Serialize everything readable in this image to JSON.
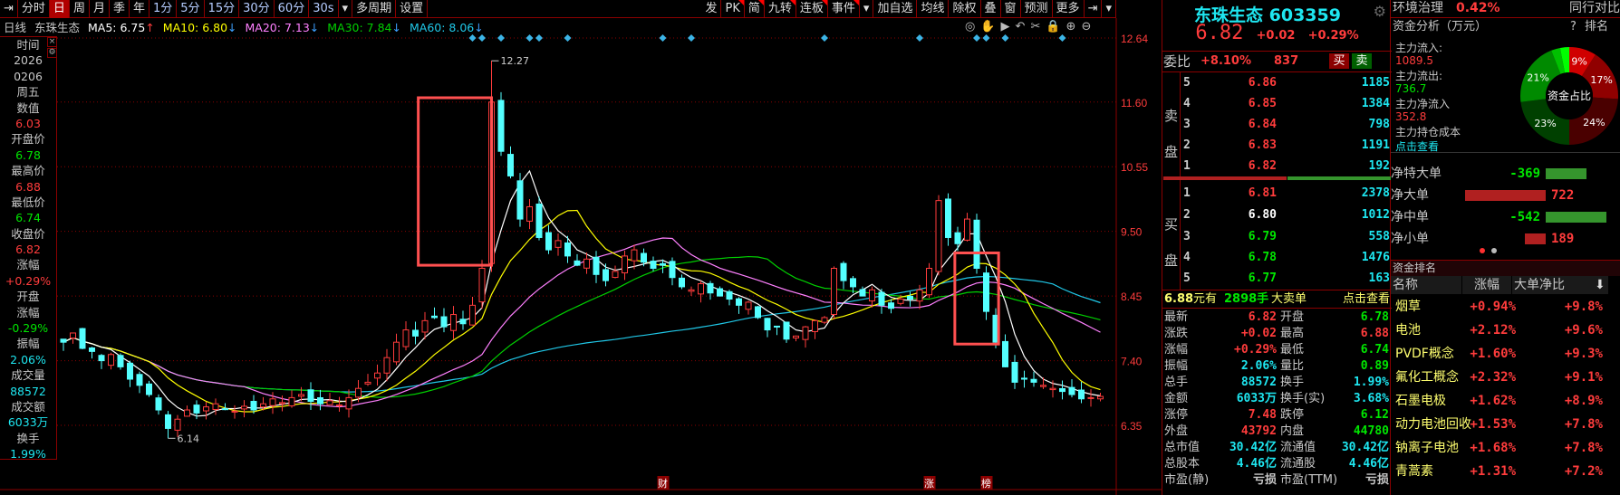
{
  "toolbar": {
    "left": [
      {
        "label": "⇥",
        "icon": "collapse-icon"
      },
      {
        "label": "分时"
      },
      {
        "label": "日",
        "active": true
      },
      {
        "label": "周"
      },
      {
        "label": "月"
      },
      {
        "label": "季"
      },
      {
        "label": "年"
      },
      {
        "label": "1分",
        "blue": true
      },
      {
        "label": "5分",
        "blue": true
      },
      {
        "label": "15分",
        "blue": true
      },
      {
        "label": "30分",
        "blue": true
      },
      {
        "label": "60分",
        "blue": true
      },
      {
        "label": "30s",
        "blue": true
      },
      {
        "label": "▾",
        "icon": "dropdown-icon"
      },
      {
        "label": "多周期"
      },
      {
        "label": "设置"
      }
    ],
    "right": [
      {
        "label": "发"
      },
      {
        "label": "PK",
        "flag": true
      },
      {
        "label": "简",
        "flag": true
      },
      {
        "label": "九转",
        "flag": true
      },
      {
        "label": "连板",
        "flag": true
      },
      {
        "label": "事件",
        "flag": true
      },
      {
        "label": "▾",
        "icon": "dropdown-icon"
      },
      {
        "label": "加自选"
      },
      {
        "label": "均线"
      },
      {
        "label": "除权"
      },
      {
        "label": "叠"
      },
      {
        "label": "窗"
      },
      {
        "label": "预测"
      },
      {
        "label": "更多"
      },
      {
        "label": "⇥",
        "icon": "expand-icon"
      },
      {
        "label": "▾",
        "icon": "dropdown-icon"
      }
    ],
    "chart_tools": [
      "eye-icon",
      "hand-icon",
      "play-icon",
      "undo-icon",
      "scissors-icon",
      "lock-icon",
      "zoom-in-icon",
      "zoom-out-icon"
    ]
  },
  "ma_row": {
    "period": "日线",
    "name": "东珠生态",
    "ma5": "MA5: 6.75",
    "ma5_arrow": "↑",
    "ma10": "MA10: 6.80",
    "ma10_arrow": "↓",
    "ma20": "MA20: 7.13",
    "ma20_arrow": "↓",
    "ma30": "MA30: 7.84",
    "ma30_arrow": "↓",
    "ma60": "MA60: 8.06",
    "ma60_arrow": "↓"
  },
  "left_panel": [
    [
      "时间",
      "gr"
    ],
    [
      "2026",
      "gr"
    ],
    [
      "0206",
      "gr"
    ],
    [
      "周五",
      "gr"
    ],
    [
      "数值",
      "gr"
    ],
    [
      "6.03",
      "r"
    ],
    [
      "开盘价",
      "gr"
    ],
    [
      "6.78",
      "g"
    ],
    [
      "最高价",
      "gr"
    ],
    [
      "6.88",
      "r"
    ],
    [
      "最低价",
      "gr"
    ],
    [
      "6.74",
      "g"
    ],
    [
      "收盘价",
      "gr"
    ],
    [
      "6.82",
      "r"
    ],
    [
      "涨幅",
      "gr"
    ],
    [
      "+0.29%",
      "r"
    ],
    [
      "开盘",
      "gr"
    ],
    [
      "涨幅",
      "gr"
    ],
    [
      "-0.29%",
      "g"
    ],
    [
      "振幅",
      "gr"
    ],
    [
      "2.06%",
      "c"
    ],
    [
      "成交量",
      "gr"
    ],
    [
      "88572",
      "c"
    ],
    [
      "成交额",
      "gr"
    ],
    [
      "6033万",
      "c"
    ],
    [
      "换手",
      "gr"
    ],
    [
      "1.99%",
      "c"
    ]
  ],
  "chart_data": {
    "type": "candlestick",
    "yticks": [
      "12.64",
      "11.60",
      "10.55",
      "9.50",
      "8.45",
      "7.40",
      "6.35"
    ],
    "closes": [
      7.7,
      7.85,
      7.6,
      7.55,
      7.4,
      7.5,
      7.3,
      7.1,
      7.0,
      6.85,
      6.6,
      6.3,
      6.45,
      6.6,
      6.55,
      6.65,
      6.7,
      6.62,
      6.58,
      6.66,
      6.6,
      6.7,
      6.78,
      6.72,
      6.8,
      6.85,
      6.74,
      6.7,
      6.75,
      6.68,
      6.8,
      6.95,
      7.05,
      7.2,
      7.45,
      7.7,
      7.9,
      7.8,
      8.05,
      8.1,
      7.95,
      8.15,
      8.0,
      8.3,
      8.9,
      11.6,
      10.8,
      10.4,
      9.7,
      9.9,
      9.4,
      9.2,
      9.35,
      9.1,
      8.95,
      9.05,
      8.8,
      8.7,
      8.85,
      9.1,
      9.2,
      9.0,
      8.9,
      8.95,
      8.75,
      8.6,
      8.55,
      8.65,
      8.5,
      8.45,
      8.4,
      8.3,
      8.35,
      8.1,
      7.9,
      7.95,
      7.75,
      7.8,
      7.95,
      8.05,
      8.1,
      8.9,
      8.7,
      8.6,
      8.45,
      8.55,
      8.3,
      8.25,
      8.4,
      8.4,
      8.55,
      8.9,
      10.0,
      9.4,
      9.3,
      9.7,
      8.9,
      8.2,
      7.7,
      7.3,
      7.05,
      7.1,
      7.05,
      7.0,
      6.95,
      6.9,
      6.85,
      6.78,
      6.8,
      6.82
    ],
    "last_bar": {
      "open": 6.78,
      "high": 6.88,
      "low": 6.74,
      "close": 6.82
    },
    "annotations": [
      {
        "index": 11,
        "price": 6.14,
        "label": "6.14"
      },
      {
        "index": 45,
        "price": 12.27,
        "label": "12.27"
      }
    ],
    "boxes": [
      {
        "from": 37.3,
        "to": 45,
        "high": 11.67,
        "low": 8.95
      },
      {
        "from": 93.7,
        "to": 98.3,
        "high": 9.15,
        "low": 7.67
      }
    ],
    "event_markers": [
      43,
      44,
      46,
      49,
      50,
      53,
      63,
      66,
      80,
      90,
      96,
      97,
      99,
      105
    ],
    "bottom_labels": [
      {
        "index": 63,
        "label": "财"
      },
      {
        "index": 91,
        "label": "涨"
      },
      {
        "index": 97,
        "label": "榜"
      }
    ],
    "ma_colors": {
      "ma5": "#ffffff",
      "ma10": "#ffff00",
      "ma20": "#ff80ff",
      "ma30": "#00d000",
      "ma60": "#20c8e8"
    },
    "up_color": "#ff3c3c",
    "down_color": "#54ffff"
  },
  "quote": {
    "name": "东珠生态 603359",
    "price": "6.82",
    "change": "+0.02",
    "pct": "+0.29%",
    "wb_label": "委比",
    "wb": "+8.10%",
    "wc": "837",
    "buy": "买",
    "sell": "卖",
    "sell_label": "卖盘",
    "buy_label": "买盘",
    "sells": [
      [
        "5",
        "6.86",
        "1185",
        "r"
      ],
      [
        "4",
        "6.85",
        "1384",
        "r"
      ],
      [
        "3",
        "6.84",
        "798",
        "r"
      ],
      [
        "2",
        "6.83",
        "1191",
        "r"
      ],
      [
        "1",
        "6.82",
        "192",
        "r"
      ]
    ],
    "buys": [
      [
        "1",
        "6.81",
        "2378",
        "r"
      ],
      [
        "2",
        "6.80",
        "1012",
        "w"
      ],
      [
        "3",
        "6.79",
        "558",
        "g"
      ],
      [
        "4",
        "6.78",
        "1476",
        "g"
      ],
      [
        "5",
        "6.77",
        "163",
        "g"
      ]
    ],
    "big_order": {
      "price": "6.88",
      "unit": "元有",
      "vol": "2898手",
      "type": "大卖单",
      "link": "点击查看"
    },
    "stats": [
      [
        "最新",
        "6.82",
        "r",
        "开盘",
        "6.78",
        "g"
      ],
      [
        "涨跌",
        "+0.02",
        "r",
        "最高",
        "6.88",
        "r"
      ],
      [
        "涨幅",
        "+0.29%",
        "r",
        "最低",
        "6.74",
        "g"
      ],
      [
        "振幅",
        "2.06%",
        "c",
        "量比",
        "0.89",
        "g"
      ],
      [
        "总手",
        "88572",
        "c",
        "换手",
        "1.99%",
        "c"
      ],
      [
        "金额",
        "6033万",
        "c",
        "换手(实)",
        "3.68%",
        "c"
      ],
      [
        "涨停",
        "7.48",
        "r",
        "跌停",
        "6.12",
        "g"
      ],
      [
        "外盘",
        "43792",
        "r",
        "内盘",
        "44780",
        "g"
      ],
      [
        "总市值",
        "30.42亿",
        "c",
        "流通值",
        "30.42亿",
        "c"
      ],
      [
        "总股本",
        "4.46亿",
        "c",
        "流通股",
        "4.46亿",
        "c"
      ],
      [
        "市盈(静)",
        "亏损",
        "gr",
        "市盈(TTM)",
        "亏损",
        "gr"
      ]
    ]
  },
  "right_panel": {
    "sector": "环境治理",
    "sector_pct": "0.42%",
    "compare": "同行对比",
    "fund_title": "资金分析（万元）",
    "help": "?",
    "rank_link": "排名",
    "flows": [
      [
        "主力流入:",
        "gr"
      ],
      [
        "1089.5",
        "r"
      ],
      [
        "主力流出:",
        "gr"
      ],
      [
        "736.7",
        "g"
      ],
      [
        "主力净流入",
        "gr"
      ],
      [
        "352.8",
        "r"
      ],
      [
        "主力持仓成本",
        "gr"
      ],
      [
        "点击查看",
        "c"
      ]
    ],
    "donut": {
      "center": "资金占比",
      "slices": [
        {
          "v": 9,
          "label": "9%",
          "color": "#d00000"
        },
        {
          "v": 17,
          "label": "17%",
          "color": "#900000"
        },
        {
          "v": 24,
          "label": "24%",
          "color": "#4a0000"
        },
        {
          "v": 23,
          "label": "23%",
          "color": "#004000"
        },
        {
          "v": 21,
          "label": "21%",
          "color": "#008a00"
        },
        {
          "v": 3,
          "label": "",
          "color": "#00c000"
        },
        {
          "v": 3,
          "label": "",
          "color": "#00ff00"
        }
      ]
    },
    "net": [
      {
        "label": "净特大单",
        "value": -369
      },
      {
        "label": "净大单",
        "value": 722
      },
      {
        "label": "净中单",
        "value": -542
      },
      {
        "label": "净小单",
        "value": 189
      }
    ],
    "rank_title": "资金排名",
    "cols": [
      "名称",
      "涨幅",
      "大单净比"
    ],
    "ranks": [
      [
        "烟草",
        "+0.94%",
        "+9.8%"
      ],
      [
        "电池",
        "+2.12%",
        "+9.6%"
      ],
      [
        "PVDF概念",
        "+1.60%",
        "+9.3%"
      ],
      [
        "氟化工概念",
        "+2.32%",
        "+9.1%"
      ],
      [
        "石墨电极",
        "+1.62%",
        "+8.9%"
      ],
      [
        "动力电池回收",
        "+1.53%",
        "+7.8%"
      ],
      [
        "钠离子电池",
        "+1.68%",
        "+7.8%"
      ],
      [
        "青蒿素",
        "+1.31%",
        "+7.2%"
      ]
    ]
  }
}
